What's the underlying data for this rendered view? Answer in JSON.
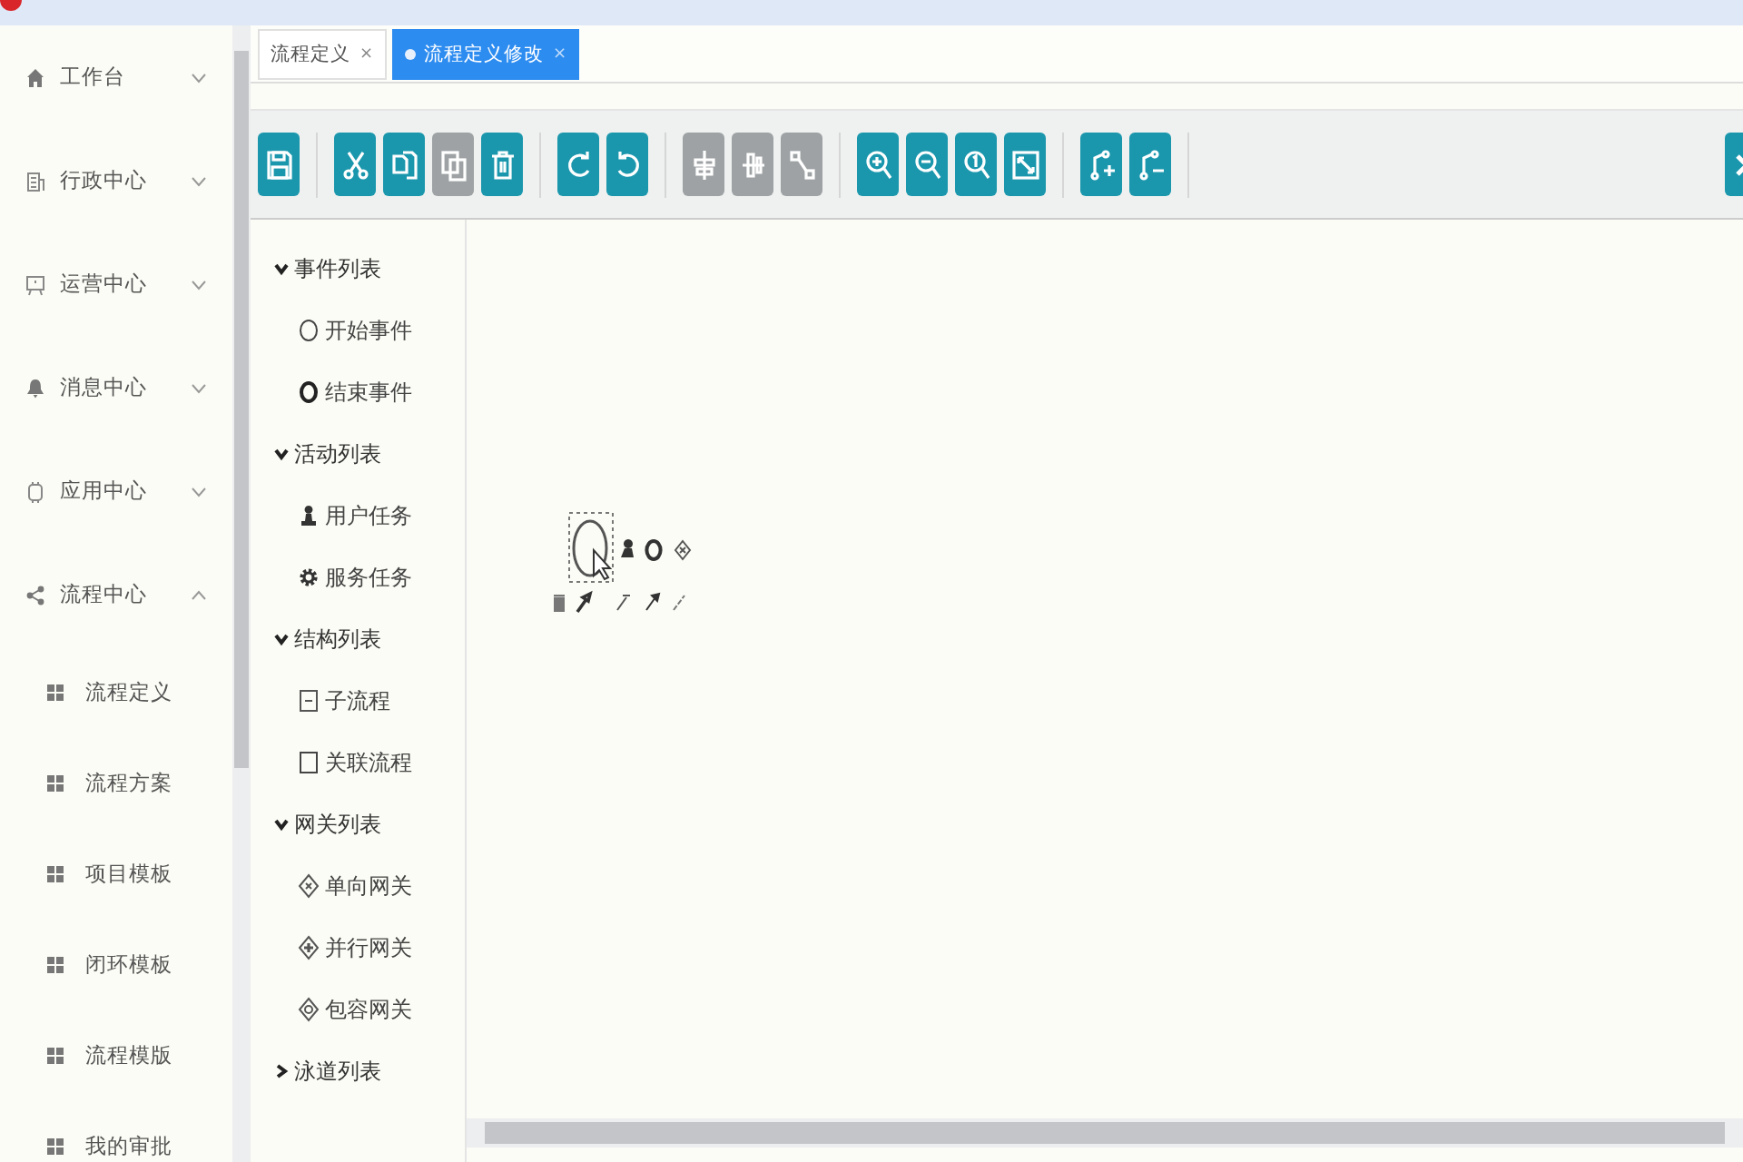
{
  "sidebar": {
    "items": [
      {
        "label": "工作台",
        "expanded": false
      },
      {
        "label": "行政中心",
        "expanded": false
      },
      {
        "label": "运营中心",
        "expanded": false
      },
      {
        "label": "消息中心",
        "expanded": false
      },
      {
        "label": "应用中心",
        "expanded": false
      },
      {
        "label": "流程中心",
        "expanded": true,
        "children": [
          {
            "label": "流程定义"
          },
          {
            "label": "流程方案"
          },
          {
            "label": "项目模板"
          },
          {
            "label": "闭环模板"
          },
          {
            "label": "流程模版"
          },
          {
            "label": "我的审批"
          }
        ]
      }
    ]
  },
  "tabs": [
    {
      "label": "流程定义",
      "close": "×",
      "selected": false
    },
    {
      "label": "流程定义修改",
      "close": "×",
      "selected": true
    }
  ],
  "toolbar": {
    "groups": [
      [
        {
          "kind": "save",
          "disabled": false
        }
      ],
      [
        {
          "kind": "cut",
          "disabled": false
        },
        {
          "kind": "copy",
          "disabled": false
        },
        {
          "kind": "paste",
          "disabled": true
        },
        {
          "kind": "delete",
          "disabled": false
        }
      ],
      [
        {
          "kind": "redo",
          "disabled": false
        },
        {
          "kind": "undo",
          "disabled": false
        }
      ],
      [
        {
          "kind": "align-horizontal",
          "disabled": true
        },
        {
          "kind": "align-vertical",
          "disabled": true
        },
        {
          "kind": "resize",
          "disabled": true
        }
      ],
      [
        {
          "kind": "zoom-in",
          "disabled": false
        },
        {
          "kind": "zoom-out",
          "disabled": false
        },
        {
          "kind": "zoom-reset",
          "disabled": false
        },
        {
          "kind": "fit",
          "disabled": false
        }
      ],
      [
        {
          "kind": "add-line",
          "disabled": false
        },
        {
          "kind": "remove-line",
          "disabled": false
        }
      ]
    ],
    "right": [
      {
        "kind": "close",
        "disabled": false
      }
    ]
  },
  "palette": {
    "sections": [
      {
        "title": "事件列表",
        "expanded": true,
        "items": [
          {
            "label": "开始事件",
            "kind": "start-event"
          },
          {
            "label": "结束事件",
            "kind": "end-event"
          }
        ]
      },
      {
        "title": "活动列表",
        "expanded": true,
        "items": [
          {
            "label": "用户任务",
            "kind": "user-task"
          },
          {
            "label": "服务任务",
            "kind": "service-task"
          }
        ]
      },
      {
        "title": "结构列表",
        "expanded": true,
        "items": [
          {
            "label": "子流程",
            "kind": "subprocess"
          },
          {
            "label": "关联流程",
            "kind": "call-activity"
          }
        ]
      },
      {
        "title": "网关列表",
        "expanded": true,
        "items": [
          {
            "label": "单向网关",
            "kind": "exclusive-gateway"
          },
          {
            "label": "并行网关",
            "kind": "parallel-gateway"
          },
          {
            "label": "包容网关",
            "kind": "inclusive-gateway"
          }
        ]
      },
      {
        "title": "泳道列表",
        "expanded": false
      }
    ]
  }
}
